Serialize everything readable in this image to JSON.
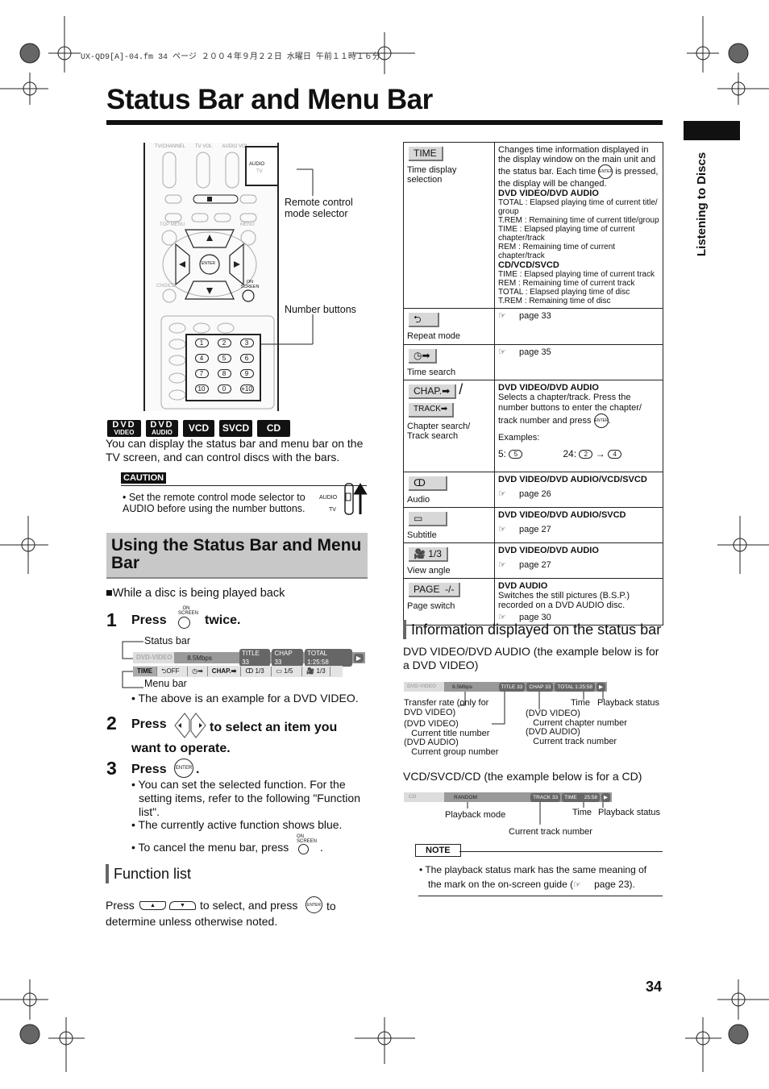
{
  "header_line": "UX-QD9[A]-04.fm  34 ページ  ２００４年９月２２日  水曜日  午前１１時１６分",
  "title": "Status Bar and Menu Bar",
  "side_tab": "Listening to Discs",
  "remote": {
    "labels": [
      "TV/CHANNEL",
      "TV VOL",
      "AUDIO VOL"
    ],
    "selector_label": "Remote control mode selector",
    "number_label": "Number buttons",
    "audio": "AUDIO",
    "tv": "TV",
    "enter": "ENTER",
    "on_screen": "ON SCREEN",
    "choice": "CHOICE",
    "top_menu": "TOP MENU",
    "menu": "MENU",
    "numbers": [
      "1",
      "2",
      "3",
      "4",
      "5",
      "6",
      "7",
      "8",
      "9",
      "10",
      "0",
      "+10"
    ]
  },
  "discs": [
    {
      "l1": "DVD",
      "l2": "VIDEO"
    },
    {
      "l1": "DVD",
      "l2": "AUDIO"
    },
    {
      "l1": "VCD"
    },
    {
      "l1": "SVCD"
    },
    {
      "l1": "CD"
    }
  ],
  "intro": "You can display the status bar and menu bar on the TV screen, and can control discs with the bars.",
  "caution": {
    "label": "CAUTION",
    "text": "• Set the remote control mode selector to AUDIO before using the number buttons.",
    "audio": "AUDIO",
    "tv": "TV"
  },
  "section_title": "Using the Status Bar and Menu Bar",
  "while": "■While a disc is being played back",
  "steps": [
    {
      "n": "1",
      "pre": "Press",
      "post": "twice.",
      "btn": "ON SCREEN"
    },
    {
      "n": "2",
      "pre": "Press",
      "post": "to select an item you want to operate."
    },
    {
      "n": "3",
      "pre": "Press",
      "post": ".",
      "btn": "ENTER"
    }
  ],
  "status_label": "Status bar",
  "menu_label": "Menu bar",
  "statusbar": {
    "disc": "DVD-VIDEO",
    "rate": "8.5Mbps",
    "title": "TITLE 33",
    "chap": "CHAP 33",
    "total": "TOTAL   1:25:58",
    "play": "▶"
  },
  "menubar": [
    "TIME",
    "⮌OFF",
    "◷➡",
    "CHAP.➡",
    "ↀ 1/3",
    "▭ 1/5",
    "🎥 1/3"
  ],
  "example_note": "• The above is an example for a DVD VIDEO.",
  "step3_bullets": [
    "• You can set the selected function. For the setting items, refer to the following \"Function list\".",
    "• The currently active function shows blue."
  ],
  "cancel": "• To cancel the menu bar, press",
  "function_list": {
    "title": "Function list",
    "text_a": "Press",
    "text_b": "to select, and press",
    "text_c": "to determine unless otherwise noted.",
    "up": "▲",
    "down": "▼"
  },
  "table": [
    {
      "btn": "TIME",
      "name": "Time display selection",
      "desc_a": "Changes time information displayed in the display window on the main unit and the status bar. Each time",
      "desc_b": "is pressed, the display will be changed.",
      "h1": "DVD VIDEO/DVD AUDIO",
      "items1": [
        "TOTAL : Elapsed playing time of current title/ group",
        "T.REM : Remaining time of current title/group",
        "TIME : Elapsed playing time of current chapter/track",
        "REM : Remaining time of current chapter/track"
      ],
      "h2": "CD/VCD/SVCD",
      "items2": [
        "TIME : Elapsed playing time of current track",
        "REM : Remaining time of current track",
        "TOTAL : Elapsed playing time of disc",
        "T.REM : Remaining time of disc"
      ]
    },
    {
      "btn": "⮌",
      "name": "Repeat mode",
      "page": "page 33"
    },
    {
      "btn": "◷➡",
      "name": "Time search",
      "page": "page 35"
    },
    {
      "btn": "CHAP.➡",
      "btn2": "TRACK➡",
      "slash": "/",
      "name": "Chapter search/ Track search",
      "h": "DVD VIDEO/DVD AUDIO",
      "desc_a": "Selects a chapter/track. Press the number buttons to enter the chapter/ track number and press",
      "examples": "Examples:",
      "ex1": "5:",
      "ex2": "24:",
      "arrow": "→",
      "n5": "5",
      "n2": "2",
      "n4": "4"
    },
    {
      "btn": "ↀ",
      "name": "Audio",
      "h": "DVD VIDEO/DVD AUDIO/VCD/SVCD",
      "page": "page 26"
    },
    {
      "btn": "▭",
      "name": "Subtitle",
      "h": "DVD VIDEO/DVD AUDIO/SVCD",
      "page": "page 27"
    },
    {
      "btn": "🎥 1/3",
      "name": "View angle",
      "h": "DVD VIDEO/DVD AUDIO",
      "page": "page 27"
    },
    {
      "btn": "PAGE  -/-",
      "name": "Page switch",
      "h": "DVD AUDIO",
      "desc": "Switches the still pictures (B.S.P.) recorded on a DVD AUDIO disc.",
      "page": "page 30"
    }
  ],
  "info": {
    "title": "Information displayed on the status bar",
    "sub1": "DVD VIDEO/DVD AUDIO (the example below is for a DVD VIDEO)",
    "labels1": {
      "rate": "Transfer rate (only for DVD VIDEO)",
      "title": "(DVD VIDEO)\n   Current title number\n(DVD AUDIO)\n   Current group number",
      "chap": "(DVD VIDEO)\n   Current chapter number\n(DVD AUDIO)\n   Current track number",
      "time": "Time",
      "play": "Playback status"
    },
    "sub2": "VCD/SVCD/CD (the example below is for a CD)",
    "cdbar": {
      "disc": "CD",
      "mode": "RANDOM",
      "track": "TRACK 33",
      "time": "TIME     25:58",
      "play": "▶"
    },
    "labels2": {
      "mode": "Playback mode",
      "track": "Current track number",
      "time": "Time",
      "play": "Playback status"
    }
  },
  "note": {
    "label": "NOTE",
    "text_a": "• The playback status mark has the same meaning of the mark on the on-screen guide (",
    "text_b": "page 23)."
  },
  "ref_icon": "pointing-hand-icon",
  "page_number": "34"
}
